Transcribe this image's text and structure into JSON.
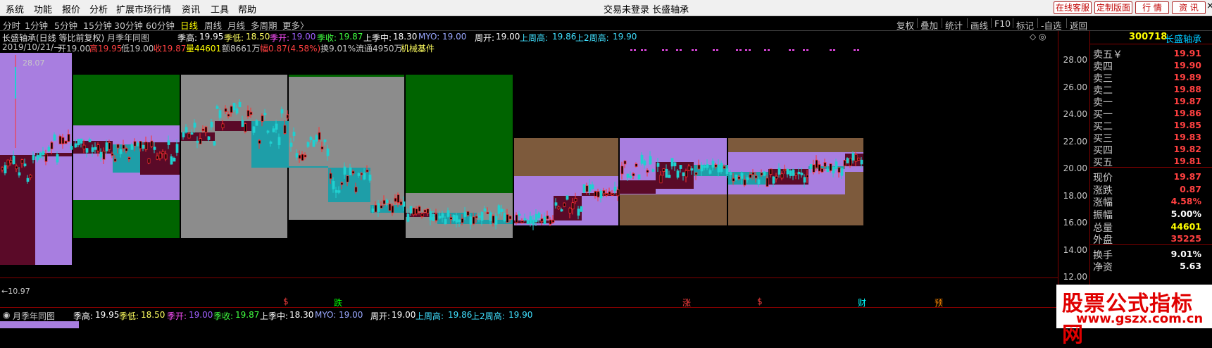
{
  "menu": {
    "items": [
      "系统",
      "功能",
      "报价",
      "分析",
      "扩展市场行情",
      "资讯",
      "工具",
      "帮助"
    ],
    "center_title": "交易未登录  长盛轴承",
    "buttons": [
      "在线客服",
      "定制版面",
      "行  情",
      "资  讯"
    ]
  },
  "periods": [
    "分时",
    "1分钟",
    "5分钟",
    "15分钟",
    "30分钟",
    "60分钟",
    "日线",
    "周线",
    "月线",
    "多周期",
    "更多〉"
  ],
  "active_period": "日线",
  "tools": [
    "复权",
    "叠加",
    "统计",
    "画线",
    "F10",
    "标记",
    "-自选",
    "返回"
  ],
  "stock": {
    "code": "300718",
    "name": "长盛轴承"
  },
  "chart_header": {
    "title": "长盛轴承(日线 等比前复权)",
    "indicator": "月季年同图",
    "season_high_label": "季高:",
    "season_high": "19.95",
    "season_low_label": "季低:",
    "season_low": "18.50",
    "season_open_label": "季开:",
    "season_open": "19.00",
    "season_close_label": "季收:",
    "season_close": "19.87",
    "prev_season_mid_label": "上季中:",
    "prev_season_mid": "18.30",
    "myo_label": "MYO:",
    "myo": "19.00",
    "week_open_label": "周开:",
    "week_open": "19.00",
    "prev_week_high_label": "上周高:",
    "prev_week_high": "19.86",
    "prev2_week_high_label": "上2周高:",
    "prev2_week_high": "19.90"
  },
  "bar_info": {
    "date": "2019/10/21/—",
    "open": "开19.00",
    "high": "高19.95",
    "low": "低19.00",
    "close": "收19.87",
    "vol": "量44601",
    "amount": "额8661万",
    "change": "幅0.87(4.58%)",
    "turnover": "换9.01%",
    "float": "流通4950万",
    "sector": "机械基件"
  },
  "chart_labels": {
    "max": "28.07",
    "min": "←10.97"
  },
  "price_ticks": [
    "28.00",
    "26.00",
    "24.00",
    "22.00",
    "20.00",
    "18.00",
    "16.00",
    "14.00",
    "12.00"
  ],
  "event_markers": [
    {
      "text": "$",
      "color": "#ff4040"
    },
    {
      "text": "跌",
      "color": "#00ff00"
    },
    {
      "text": "涨",
      "color": "#ff4040"
    },
    {
      "text": "$",
      "color": "#ff4040"
    },
    {
      "text": "财",
      "color": "#00ffff"
    },
    {
      "text": "预",
      "color": "#ff8800"
    }
  ],
  "quotes": [
    {
      "label": "卖五￥",
      "value": "19.91",
      "color": "#ff4040"
    },
    {
      "label": "卖四",
      "value": "19.90",
      "color": "#ff4040"
    },
    {
      "label": "卖三",
      "value": "19.89",
      "color": "#ff4040"
    },
    {
      "label": "卖二",
      "value": "19.88",
      "color": "#ff4040"
    },
    {
      "label": "卖一",
      "value": "19.87",
      "color": "#ff4040"
    },
    {
      "label": "买一",
      "value": "19.86",
      "color": "#ff4040"
    },
    {
      "label": "买二",
      "value": "19.85",
      "color": "#ff4040"
    },
    {
      "label": "买三",
      "value": "19.83",
      "color": "#ff4040"
    },
    {
      "label": "买四",
      "value": "19.82",
      "color": "#ff4040"
    },
    {
      "label": "买五",
      "value": "19.81",
      "color": "#ff4040"
    },
    {
      "label": "现价",
      "value": "19.87",
      "color": "#ff4040"
    },
    {
      "label": "涨跌",
      "value": "0.87",
      "color": "#ff4040"
    },
    {
      "label": "涨幅",
      "value": "4.58%",
      "color": "#ff4040"
    },
    {
      "label": "振幅",
      "value": "5.00%",
      "color": "#ffffff"
    },
    {
      "label": "总量",
      "value": "44601",
      "color": "#ffff00"
    },
    {
      "label": "外盘",
      "value": "35225",
      "color": "#ff4040"
    },
    {
      "label": "换手",
      "value": "9.01%",
      "color": "#ffffff"
    },
    {
      "label": "净资",
      "value": "5.63",
      "color": "#ffffff"
    }
  ],
  "watermark": {
    "title": "股票公式指标网",
    "url": "www.gszx.com.cn"
  },
  "colors": {
    "purple": "#a87ee0",
    "green": "#006400",
    "gray": "#8c8c8c",
    "brown": "#7d5a3c",
    "maroon": "#5a0a28",
    "teal": "#1e9ea8",
    "up": "#ff3030",
    "down": "#20d0d0"
  }
}
